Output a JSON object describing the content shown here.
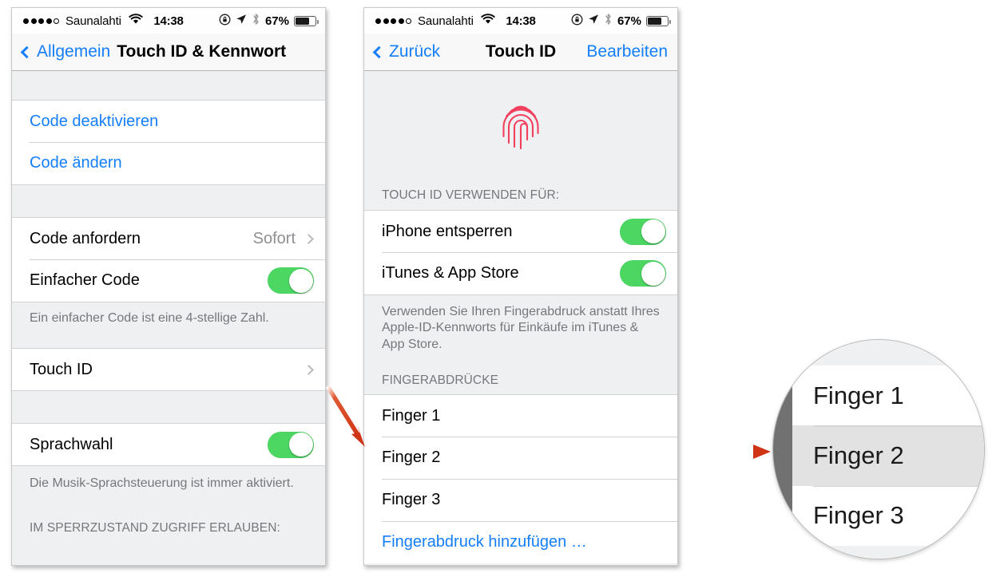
{
  "statusbar": {
    "carrier": "Saunalahti",
    "time": "14:38",
    "battery_percent": "67%",
    "signal_dots_filled": 4,
    "signal_dots_total": 5,
    "icons": [
      "wifi-icon",
      "rotation-lock-icon",
      "location-arrow-icon",
      "bluetooth-icon",
      "battery-icon"
    ]
  },
  "screen_left": {
    "nav": {
      "back_label": "Allgemein",
      "title": "Touch ID & Kennwort"
    },
    "rows": {
      "disable_code": "Code deaktivieren",
      "change_code": "Code ändern",
      "require_code_label": "Code anfordern",
      "require_code_value": "Sofort",
      "simple_code_label": "Einfacher Code",
      "simple_code_state": "on",
      "simple_code_footnote": "Ein einfacher Code ist eine 4-stellige Zahl.",
      "touch_id_label": "Touch ID",
      "voice_dial_label": "Sprachwahl",
      "voice_dial_state": "on",
      "voice_dial_footnote": "Die Musik-Sprachsteuerung ist immer aktiviert.",
      "lockscreen_header": "IM SPERRZUSTAND ZUGRIFF ERLAUBEN:"
    }
  },
  "screen_right": {
    "nav": {
      "back_label": "Zurück",
      "title": "Touch ID",
      "edit_label": "Bearbeiten"
    },
    "hero_icon": "fingerprint-icon",
    "use_for_header": "TOUCH ID VERWENDEN FÜR:",
    "rows": {
      "unlock_iphone_label": "iPhone entsperren",
      "unlock_iphone_state": "on",
      "itunes_label": "iTunes & App Store",
      "itunes_state": "on",
      "itunes_footnote": "Verwenden Sie Ihren Fingerabdruck anstatt Ihres Apple-ID-Kennworts für Einkäufe im iTunes & App Store.",
      "fingerprints_header": "FINGERABDRÜCKE",
      "fingerprints": [
        "Finger 1",
        "Finger 2",
        "Finger 3"
      ],
      "add_fingerprint": "Fingerabdruck hinzufügen …"
    }
  },
  "magnifier": {
    "rows": [
      "Finger 1",
      "Finger 2",
      "Finger 3"
    ],
    "selected_index": 1
  },
  "colors": {
    "accent_blue": "#147efb",
    "switch_green": "#4cd763",
    "fingerprint_pink": "#f2415f",
    "arrow_red": "#d83a1a",
    "group_background": "#eff0f2",
    "secondary_text": "#76767c"
  }
}
